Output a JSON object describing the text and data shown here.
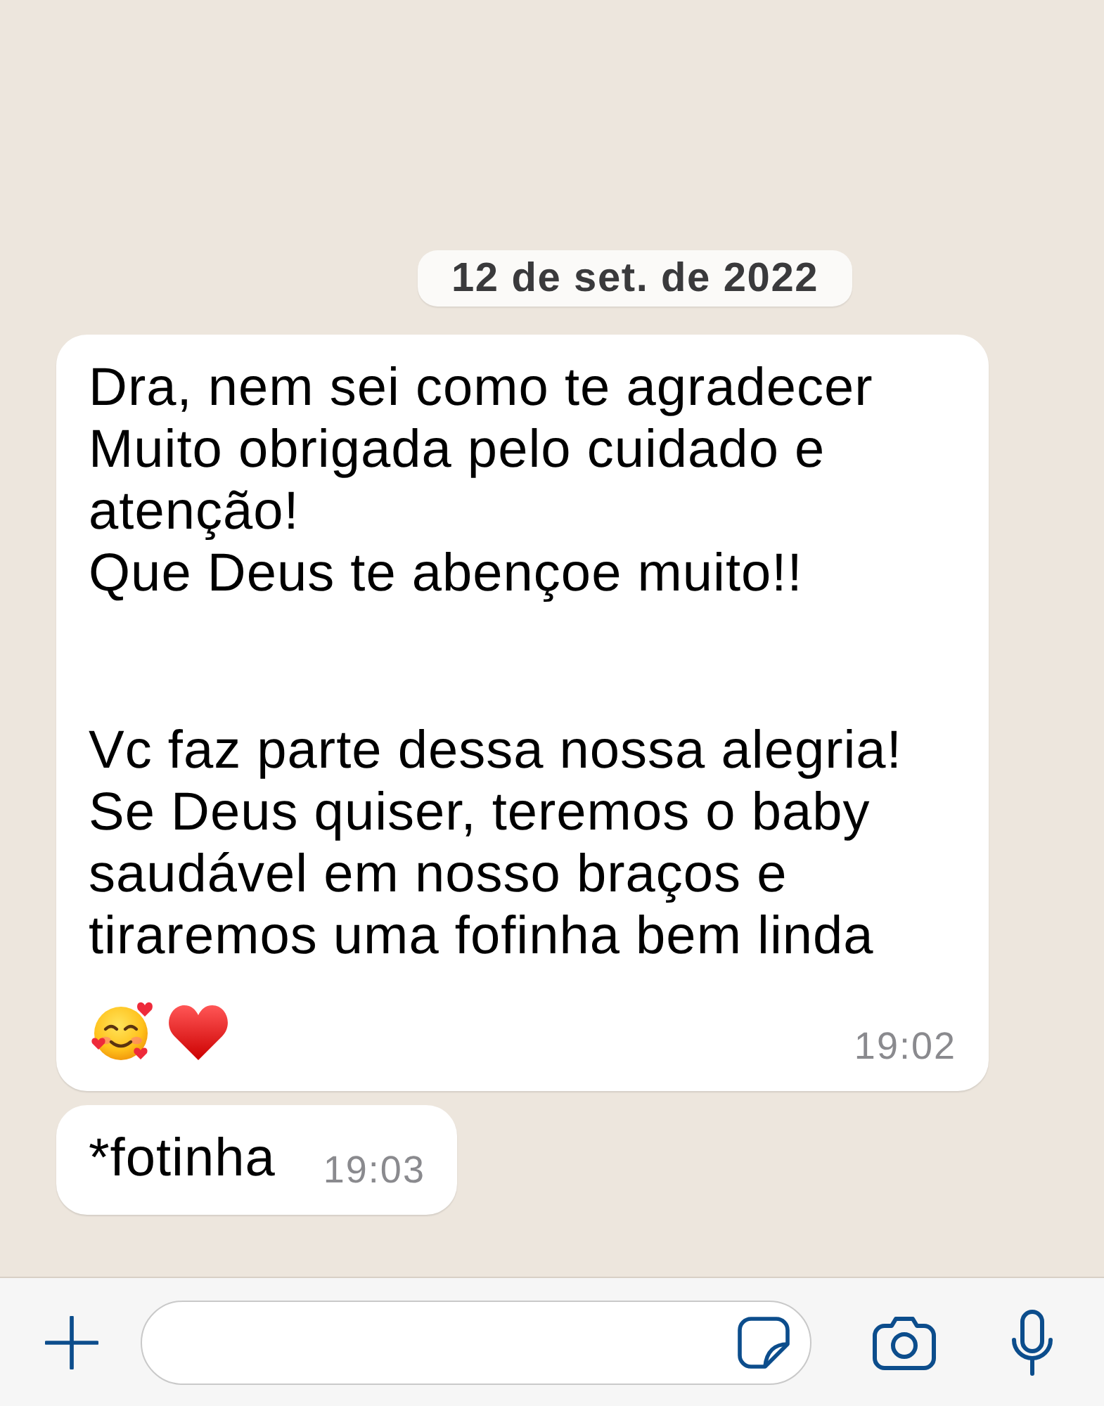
{
  "chat": {
    "date_label": "12 de set. de 2022",
    "messages": [
      {
        "paragraphs": [
          "Dra, nem sei como te agradecer\nMuito obrigada pelo cuidado e\natenção!\nQue Deus te abençoe muito!!",
          "Vc faz parte dessa nossa alegria!\nSe Deus quiser, teremos o baby\nsaudável em nosso braços e\ntiraremos uma fofinha bem linda"
        ],
        "emojis": [
          {
            "kind": "smile"
          },
          {
            "kind": "heart"
          }
        ],
        "time": "19:02"
      },
      {
        "paragraphs": [
          "*fotinha"
        ],
        "time": "19:03"
      }
    ]
  }
}
